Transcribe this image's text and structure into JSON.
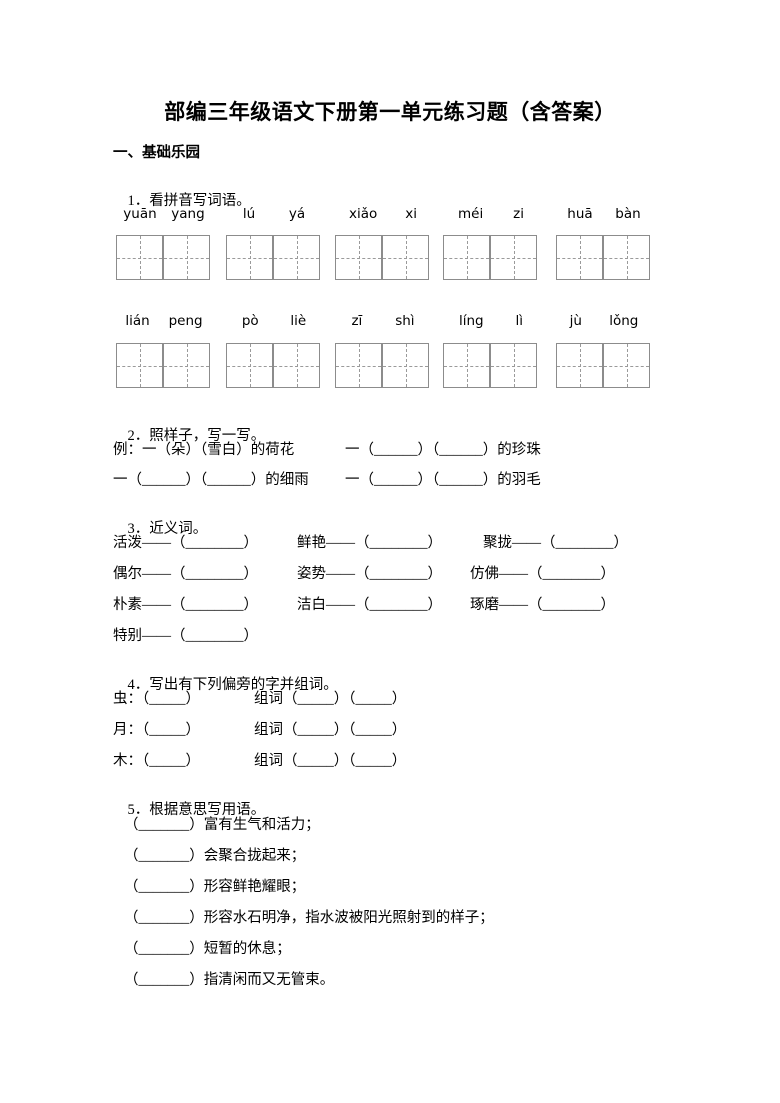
{
  "document": {
    "title": "部编三年级语文下册第一单元练习题（含答案）",
    "section_heading": "一、基础乐园"
  },
  "q1": {
    "number": "1．",
    "prompt": "看拼音写词语。",
    "rows": [
      {
        "groups": [
          {
            "syllables": [
              "yuān",
              "yang"
            ]
          },
          {
            "syllables": [
              "lú",
              "yá"
            ]
          },
          {
            "syllables": [
              "xiǎo",
              "xi"
            ]
          },
          {
            "syllables": [
              "méi",
              "zi"
            ]
          },
          {
            "syllables": [
              "huā",
              "bàn"
            ]
          }
        ]
      },
      {
        "groups": [
          {
            "syllables": [
              "lián",
              "peng"
            ]
          },
          {
            "syllables": [
              "pò",
              "liè"
            ]
          },
          {
            "syllables": [
              "zī",
              "shì"
            ]
          },
          {
            "syllables": [
              "líng",
              "lì"
            ]
          },
          {
            "syllables": [
              "jù",
              "lǒng"
            ]
          }
        ]
      }
    ]
  },
  "q2": {
    "number": "2．",
    "prompt": "照样子，写一写。",
    "line1_left": "例：一（朵）（雪白）的荷花",
    "line1_right": "一（______）（______）的珍珠",
    "line2_left": "一（______）（______）的细雨",
    "line2_right": "一（______）（______）的羽毛"
  },
  "q3": {
    "number": "3．",
    "prompt": "近义词。",
    "items": [
      "活泼——（________）",
      "鲜艳——（________）",
      "聚拢——（________）",
      "偶尔——（________）",
      "姿势——（________）",
      "仿佛——（________）",
      "朴素——（________）",
      "洁白——（________）",
      "琢磨——（________）",
      "特别——（________）"
    ]
  },
  "q4": {
    "number": "4．",
    "prompt": "写出有下列偏旁的字并组词。",
    "rows": [
      {
        "radical": "虫：（_____）",
        "compose": "组词（_____）（_____）"
      },
      {
        "radical": "月：（_____）",
        "compose": "组词（_____）（_____）"
      },
      {
        "radical": "木：（_____）",
        "compose": "组词（_____）（_____）"
      }
    ]
  },
  "q5": {
    "number": "5．",
    "prompt": "根据意思写用语。",
    "items": [
      "（_______）富有生气和活力；",
      "（_______）会聚合拢起来；",
      "（_______）形容鲜艳耀眼；",
      "（_______）形容水石明净，指水波被阳光照射到的样子；",
      "（_______）短暂的休息；",
      "（_______）指清闲而又无管束。"
    ]
  },
  "style": {
    "grid_border_color": "#8c8c8c",
    "grid_dash_color": "#9a9a9a",
    "text_color": "#000000",
    "page_background": "#ffffff"
  }
}
